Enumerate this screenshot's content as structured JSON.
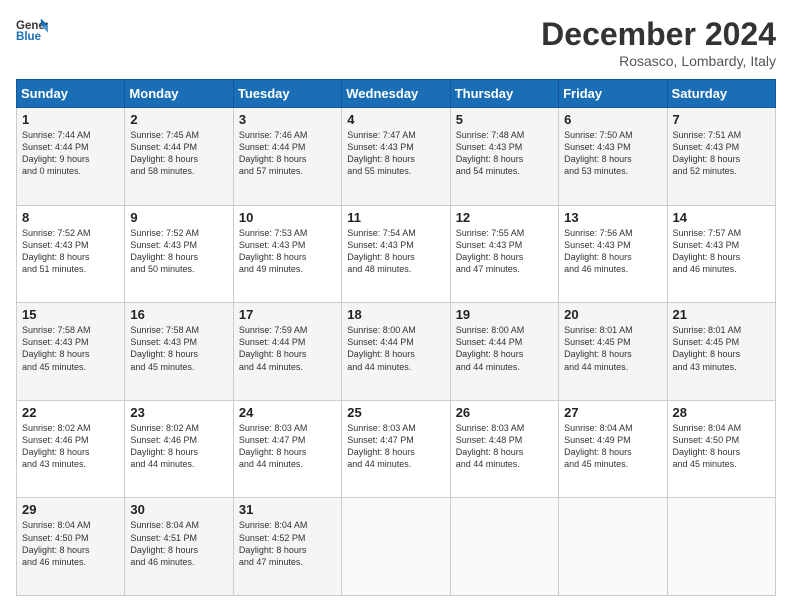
{
  "header": {
    "logo_line1": "General",
    "logo_line2": "Blue",
    "month": "December 2024",
    "location": "Rosasco, Lombardy, Italy"
  },
  "columns": [
    "Sunday",
    "Monday",
    "Tuesday",
    "Wednesday",
    "Thursday",
    "Friday",
    "Saturday"
  ],
  "rows": [
    [
      {
        "day": "1",
        "lines": [
          "Sunrise: 7:44 AM",
          "Sunset: 4:44 PM",
          "Daylight: 9 hours",
          "and 0 minutes."
        ]
      },
      {
        "day": "2",
        "lines": [
          "Sunrise: 7:45 AM",
          "Sunset: 4:44 PM",
          "Daylight: 8 hours",
          "and 58 minutes."
        ]
      },
      {
        "day": "3",
        "lines": [
          "Sunrise: 7:46 AM",
          "Sunset: 4:44 PM",
          "Daylight: 8 hours",
          "and 57 minutes."
        ]
      },
      {
        "day": "4",
        "lines": [
          "Sunrise: 7:47 AM",
          "Sunset: 4:43 PM",
          "Daylight: 8 hours",
          "and 55 minutes."
        ]
      },
      {
        "day": "5",
        "lines": [
          "Sunrise: 7:48 AM",
          "Sunset: 4:43 PM",
          "Daylight: 8 hours",
          "and 54 minutes."
        ]
      },
      {
        "day": "6",
        "lines": [
          "Sunrise: 7:50 AM",
          "Sunset: 4:43 PM",
          "Daylight: 8 hours",
          "and 53 minutes."
        ]
      },
      {
        "day": "7",
        "lines": [
          "Sunrise: 7:51 AM",
          "Sunset: 4:43 PM",
          "Daylight: 8 hours",
          "and 52 minutes."
        ]
      }
    ],
    [
      {
        "day": "8",
        "lines": [
          "Sunrise: 7:52 AM",
          "Sunset: 4:43 PM",
          "Daylight: 8 hours",
          "and 51 minutes."
        ]
      },
      {
        "day": "9",
        "lines": [
          "Sunrise: 7:52 AM",
          "Sunset: 4:43 PM",
          "Daylight: 8 hours",
          "and 50 minutes."
        ]
      },
      {
        "day": "10",
        "lines": [
          "Sunrise: 7:53 AM",
          "Sunset: 4:43 PM",
          "Daylight: 8 hours",
          "and 49 minutes."
        ]
      },
      {
        "day": "11",
        "lines": [
          "Sunrise: 7:54 AM",
          "Sunset: 4:43 PM",
          "Daylight: 8 hours",
          "and 48 minutes."
        ]
      },
      {
        "day": "12",
        "lines": [
          "Sunrise: 7:55 AM",
          "Sunset: 4:43 PM",
          "Daylight: 8 hours",
          "and 47 minutes."
        ]
      },
      {
        "day": "13",
        "lines": [
          "Sunrise: 7:56 AM",
          "Sunset: 4:43 PM",
          "Daylight: 8 hours",
          "and 46 minutes."
        ]
      },
      {
        "day": "14",
        "lines": [
          "Sunrise: 7:57 AM",
          "Sunset: 4:43 PM",
          "Daylight: 8 hours",
          "and 46 minutes."
        ]
      }
    ],
    [
      {
        "day": "15",
        "lines": [
          "Sunrise: 7:58 AM",
          "Sunset: 4:43 PM",
          "Daylight: 8 hours",
          "and 45 minutes."
        ]
      },
      {
        "day": "16",
        "lines": [
          "Sunrise: 7:58 AM",
          "Sunset: 4:43 PM",
          "Daylight: 8 hours",
          "and 45 minutes."
        ]
      },
      {
        "day": "17",
        "lines": [
          "Sunrise: 7:59 AM",
          "Sunset: 4:44 PM",
          "Daylight: 8 hours",
          "and 44 minutes."
        ]
      },
      {
        "day": "18",
        "lines": [
          "Sunrise: 8:00 AM",
          "Sunset: 4:44 PM",
          "Daylight: 8 hours",
          "and 44 minutes."
        ]
      },
      {
        "day": "19",
        "lines": [
          "Sunrise: 8:00 AM",
          "Sunset: 4:44 PM",
          "Daylight: 8 hours",
          "and 44 minutes."
        ]
      },
      {
        "day": "20",
        "lines": [
          "Sunrise: 8:01 AM",
          "Sunset: 4:45 PM",
          "Daylight: 8 hours",
          "and 44 minutes."
        ]
      },
      {
        "day": "21",
        "lines": [
          "Sunrise: 8:01 AM",
          "Sunset: 4:45 PM",
          "Daylight: 8 hours",
          "and 43 minutes."
        ]
      }
    ],
    [
      {
        "day": "22",
        "lines": [
          "Sunrise: 8:02 AM",
          "Sunset: 4:46 PM",
          "Daylight: 8 hours",
          "and 43 minutes."
        ]
      },
      {
        "day": "23",
        "lines": [
          "Sunrise: 8:02 AM",
          "Sunset: 4:46 PM",
          "Daylight: 8 hours",
          "and 44 minutes."
        ]
      },
      {
        "day": "24",
        "lines": [
          "Sunrise: 8:03 AM",
          "Sunset: 4:47 PM",
          "Daylight: 8 hours",
          "and 44 minutes."
        ]
      },
      {
        "day": "25",
        "lines": [
          "Sunrise: 8:03 AM",
          "Sunset: 4:47 PM",
          "Daylight: 8 hours",
          "and 44 minutes."
        ]
      },
      {
        "day": "26",
        "lines": [
          "Sunrise: 8:03 AM",
          "Sunset: 4:48 PM",
          "Daylight: 8 hours",
          "and 44 minutes."
        ]
      },
      {
        "day": "27",
        "lines": [
          "Sunrise: 8:04 AM",
          "Sunset: 4:49 PM",
          "Daylight: 8 hours",
          "and 45 minutes."
        ]
      },
      {
        "day": "28",
        "lines": [
          "Sunrise: 8:04 AM",
          "Sunset: 4:50 PM",
          "Daylight: 8 hours",
          "and 45 minutes."
        ]
      }
    ],
    [
      {
        "day": "29",
        "lines": [
          "Sunrise: 8:04 AM",
          "Sunset: 4:50 PM",
          "Daylight: 8 hours",
          "and 46 minutes."
        ]
      },
      {
        "day": "30",
        "lines": [
          "Sunrise: 8:04 AM",
          "Sunset: 4:51 PM",
          "Daylight: 8 hours",
          "and 46 minutes."
        ]
      },
      {
        "day": "31",
        "lines": [
          "Sunrise: 8:04 AM",
          "Sunset: 4:52 PM",
          "Daylight: 8 hours",
          "and 47 minutes."
        ]
      },
      null,
      null,
      null,
      null
    ]
  ]
}
